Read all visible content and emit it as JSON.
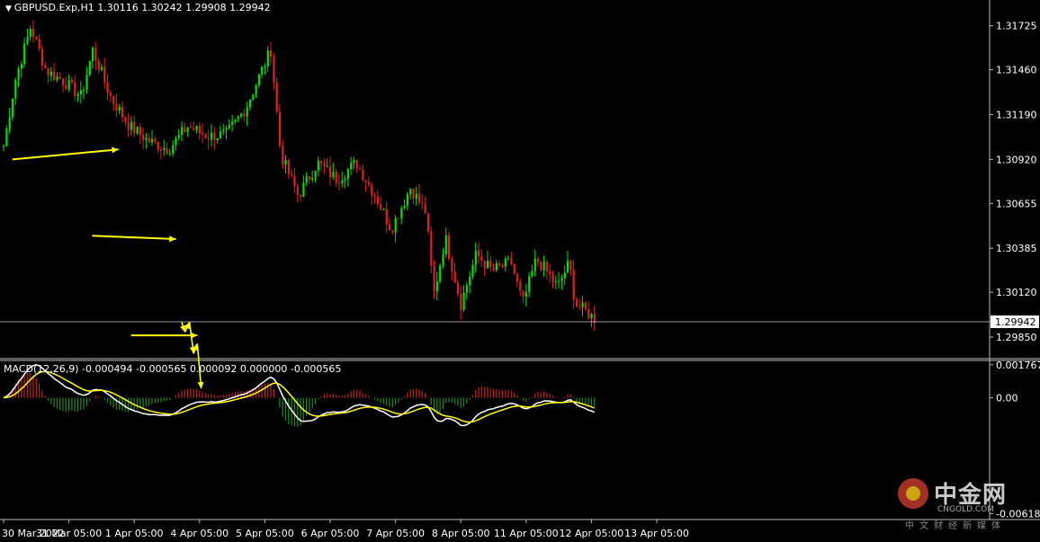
{
  "header": {
    "symbol_title": "GBPUSD.Exp,H1  1.30116 1.30242 1.29908 1.29942"
  },
  "macd": {
    "label": "MACD(12,26,9) -0.000494 -0.000565 0.000092 0.000000 -0.000565",
    "axis_ticks": [
      "0.001767",
      "0.00",
      "-0.00618"
    ]
  },
  "watermark": {
    "name_cn": "中金网",
    "name_en": "CNGOLD.COM",
    "subtitle_cn": "中文财经新媒体"
  },
  "colors": {
    "background": "#000000",
    "bull": "#00e000",
    "bear": "#e02020",
    "annotation": "#ffff00",
    "macd_line": "#ffffff",
    "signal_line": "#ffff00",
    "grid": "#c8c8c8"
  },
  "chart_data": [
    {
      "type": "candlestick",
      "title": "GBPUSD.Exp,H1  1.30116 1.30242 1.29908 1.29942",
      "x_tick_labels": [
        "30 Mar 2022",
        "31 Mar 05:00",
        "1 Apr 05:00",
        "4 Apr 05:00",
        "5 Apr 05:00",
        "6 Apr 05:00",
        "7 Apr 05:00",
        "8 Apr 05:00",
        "11 Apr 05:00",
        "12 Apr 05:00",
        "13 Apr 05:00"
      ],
      "y_tick_labels": [
        "1.31725",
        "1.31460",
        "1.31190",
        "1.30920",
        "1.30655",
        "1.30385",
        "1.30120",
        "1.29850"
      ],
      "current_price_label": "1.29942",
      "ylim": [
        1.2972,
        1.3188
      ],
      "bar_count": 200,
      "price_path": [
        [
          0,
          1.31
        ],
        [
          6,
          1.314
        ],
        [
          14,
          1.3172
        ],
        [
          22,
          1.3145
        ],
        [
          30,
          1.314
        ],
        [
          40,
          1.313
        ],
        [
          46,
          1.3158
        ],
        [
          55,
          1.313
        ],
        [
          65,
          1.3112
        ],
        [
          75,
          1.3103
        ],
        [
          85,
          1.3098
        ],
        [
          95,
          1.3112
        ],
        [
          105,
          1.3106
        ],
        [
          115,
          1.3107
        ],
        [
          125,
          1.3123
        ],
        [
          133,
          1.3145
        ],
        [
          138,
          1.3158
        ],
        [
          143,
          1.3095
        ],
        [
          152,
          1.307
        ],
        [
          162,
          1.309
        ],
        [
          172,
          1.308
        ],
        [
          182,
          1.309
        ],
        [
          192,
          1.307
        ],
        [
          200,
          1.305
        ],
        [
          210,
          1.3075
        ],
        [
          218,
          1.306
        ],
        [
          222,
          1.301
        ],
        [
          228,
          1.3045
        ],
        [
          236,
          1.3005
        ],
        [
          244,
          1.3035
        ],
        [
          252,
          1.3025
        ],
        [
          262,
          1.303
        ],
        [
          268,
          1.3005
        ],
        [
          275,
          1.3032
        ],
        [
          280,
          1.3025
        ],
        [
          286,
          1.3015
        ],
        [
          292,
          1.303
        ],
        [
          295,
          1.3005
        ],
        [
          300,
          1.3001
        ],
        [
          305,
          1.2996
        ]
      ],
      "annotations": {
        "support_resistance_lines": [
          {
            "from": [
              4.5,
              1.3092
            ],
            "to": [
              59,
              1.3098
            ],
            "arrow": true
          },
          {
            "from": [
              45.5,
              1.3046
            ],
            "to": [
              88.5,
              1.3044
            ],
            "arrow": true
          },
          {
            "from": [
              65.5,
              1.2986
            ],
            "to": [
              99.5,
              1.2986
            ],
            "arrow": true
          }
        ],
        "projected_path": [
          [
            91.5,
            1.2994
          ],
          [
            93.2,
            1.2988
          ],
          [
            95.5,
            1.2994
          ],
          [
            97.6,
            1.2975
          ],
          [
            99.5,
            1.2981
          ],
          [
            101.5,
            1.2954
          ]
        ]
      }
    },
    {
      "type": "macd",
      "title": "MACD(12,26,9) -0.000494 -0.000565 0.000092 0.000000 -0.000565",
      "params": [
        12,
        26,
        9
      ],
      "values": {
        "macd": -0.000494,
        "signal": -0.000565,
        "histogram": 9.2e-05
      },
      "ylim": [
        -0.0065,
        0.002
      ]
    }
  ]
}
